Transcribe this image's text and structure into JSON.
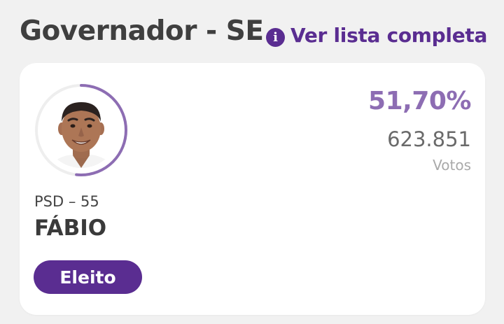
{
  "header": {
    "title": "Governador - SE",
    "info_icon": "info-icon",
    "full_list_label": "Ver lista completa"
  },
  "candidate": {
    "party": "PSD – 55",
    "name": "FÁBIO",
    "status": "Eleito",
    "vote_percent": "51,70%",
    "vote_share": 0.517,
    "votes": "623.851",
    "votes_label": "Votos",
    "avatar_icon": "candidate-photo"
  },
  "colors": {
    "accent": "#5a2d91",
    "percent": "#8d6db3",
    "ring_track": "#eeeeee",
    "title": "#3f3f3f",
    "background": "#f1f1f1",
    "card": "#ffffff"
  }
}
